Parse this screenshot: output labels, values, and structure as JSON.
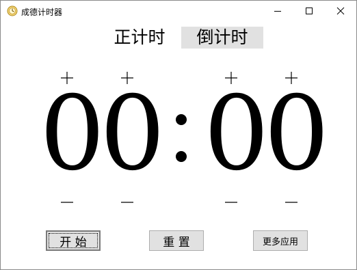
{
  "window": {
    "title": "成德计时器",
    "icon": "gold-clock-icon",
    "controls": [
      "minimize-icon",
      "maximize-icon",
      "close-icon"
    ]
  },
  "mode_tabs": {
    "count_up": "正计时",
    "count_down": "倒计时",
    "active": "count_down"
  },
  "timer": {
    "digits": [
      "0",
      "0",
      "0",
      "0"
    ],
    "separator": ":"
  },
  "buttons": {
    "start": "开 始",
    "reset": "重 置",
    "more_apps": "更多应用"
  },
  "colors": {
    "active_tab_bg": "#e1e1e1",
    "button_bg": "#e1e1e1"
  }
}
